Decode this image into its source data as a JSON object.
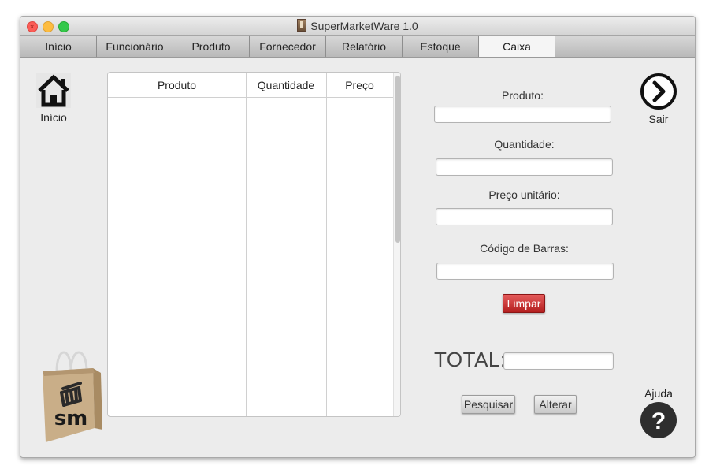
{
  "window": {
    "title": "SuperMarketWare 1.0"
  },
  "tabs": [
    {
      "label": "Início"
    },
    {
      "label": "Funcionário"
    },
    {
      "label": "Produto"
    },
    {
      "label": "Fornecedor"
    },
    {
      "label": "Relatório"
    },
    {
      "label": "Estoque"
    },
    {
      "label": "Caixa",
      "active": true
    }
  ],
  "sidebar": {
    "home_label": "Início",
    "exit_label": "Sair",
    "help_label": "Ajuda",
    "logo_text": "sm"
  },
  "table": {
    "columns": [
      "Produto",
      "Quantidade",
      "Preço"
    ],
    "rows": []
  },
  "form": {
    "produto_label": "Produto:",
    "produto_value": "",
    "quantidade_label": "Quantidade:",
    "quantidade_value": "",
    "preco_label": "Preço unitário:",
    "preco_value": "",
    "codigo_label": "Código de Barras:",
    "codigo_value": "",
    "limpar_label": "Limpar",
    "total_label": "TOTAL:",
    "total_value": "",
    "pesquisar_label": "Pesquisar",
    "alterar_label": "Alterar"
  },
  "colors": {
    "danger": "#c62828",
    "window_bg": "#ececec",
    "icon_dark": "#111111"
  },
  "icons": [
    "home-icon",
    "chevron-right-circle-icon",
    "question-icon",
    "shopping-bag-logo"
  ]
}
